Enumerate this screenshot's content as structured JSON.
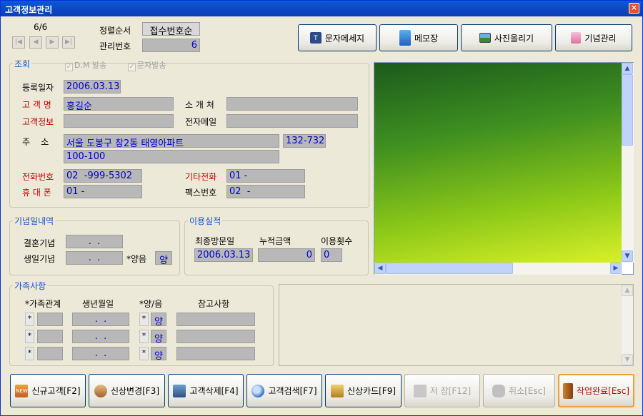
{
  "window": {
    "title": "고객정보관리",
    "close": "×"
  },
  "nav": {
    "counter": "6/6",
    "first": "|◀",
    "prev": "◀",
    "next": "▶",
    "last": "▶|"
  },
  "sort": {
    "label": "정렬순서",
    "value": "접수번호순"
  },
  "manage": {
    "label": "관리번호",
    "value": "6"
  },
  "topbuttons": [
    {
      "label": "문자메세지"
    },
    {
      "label": "메모장"
    },
    {
      "label": "사진올리기"
    },
    {
      "label": "기념관리"
    }
  ],
  "search": {
    "title": "조회",
    "dm": "D.M 발송",
    "sms": "문자발송",
    "check": "✓"
  },
  "form": {
    "reg_label": "등록일자",
    "reg_value": "2006.03.13",
    "name_label": "고 객 명",
    "name_value": "홍길순",
    "intro_label": "소 개 처",
    "intro_value": "",
    "info_label": "고객정보",
    "info_value": "",
    "email_label": "전자메일",
    "email_value": "",
    "addr_label": "주    소",
    "addr1": "서울 도봉구 창2동 태영아파트",
    "zip": "132-732",
    "addr2": "100-100",
    "phone_label": "전화번호",
    "phone_value": "02  -999-5302",
    "other_label": "기타전화",
    "other_value": "01 -",
    "mobile_label": "휴 대 폰",
    "mobile_value": "01 -",
    "fax_label": "팩스번호",
    "fax_value": "02  -"
  },
  "anniv": {
    "title": "기념일내역",
    "wed_label": "결혼기념",
    "wed_value": ".  .",
    "birth_label": "생일기념",
    "birth_value": ".  .",
    "lunar_label": "*양음",
    "lunar_value": "양"
  },
  "usage": {
    "title": "이용실적",
    "last_label": "최종방문일",
    "total_label": "누적금액",
    "count_label": "이용횟수",
    "last_value": "2006.03.13",
    "total_value": "0",
    "count_value": "0"
  },
  "family": {
    "title": "가족사항",
    "col1": "*가족관계",
    "col2": "생년월일",
    "col3": "*양/음",
    "col4": "참고사항",
    "rows": [
      {
        "star": "*",
        "birth": ".  .",
        "lstar": "*",
        "lunar": "양"
      },
      {
        "star": "*",
        "birth": ".  .",
        "lstar": "*",
        "lunar": "양"
      },
      {
        "star": "*",
        "birth": ".  .",
        "lstar": "*",
        "lunar": "양"
      }
    ]
  },
  "bottombuttons": [
    {
      "label": "신규고객[F2]"
    },
    {
      "label": "신상변경[F3]"
    },
    {
      "label": "고객삭제[F4]"
    },
    {
      "label": "고객검색[F7]"
    },
    {
      "label": "신상카드[F9]"
    },
    {
      "label": "저 장[F12]"
    },
    {
      "label": "취소[Esc]"
    },
    {
      "label": "작업완료[Esc]"
    }
  ],
  "icons": {
    "sms": "sms-icon",
    "memo": "memo-icon",
    "photo": "photo-icon",
    "gift": "gift-icon",
    "new_badge": "NEW"
  }
}
